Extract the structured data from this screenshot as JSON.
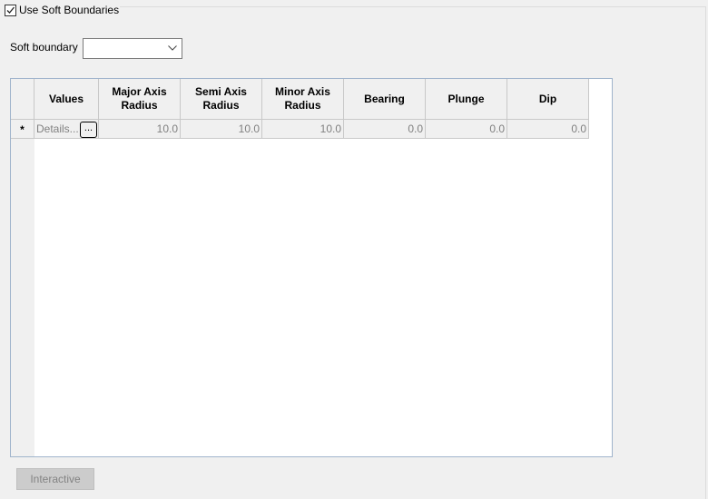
{
  "use_soft_boundaries": {
    "label": "Use Soft Boundaries",
    "checked": true
  },
  "soft_boundary": {
    "label": "Soft boundary",
    "value": ""
  },
  "grid": {
    "columns": [
      "",
      "Values",
      "Major Axis Radius",
      "Semi Axis Radius",
      "Minor Axis Radius",
      "Bearing",
      "Plunge",
      "Dip"
    ],
    "new_row": {
      "marker": "*",
      "values": "Details...",
      "details_button": "...",
      "major": "10.0",
      "semi": "10.0",
      "minor": "10.0",
      "bearing": "0.0",
      "plunge": "0.0",
      "dip": "0.0"
    }
  },
  "interactive_button": "Interactive"
}
